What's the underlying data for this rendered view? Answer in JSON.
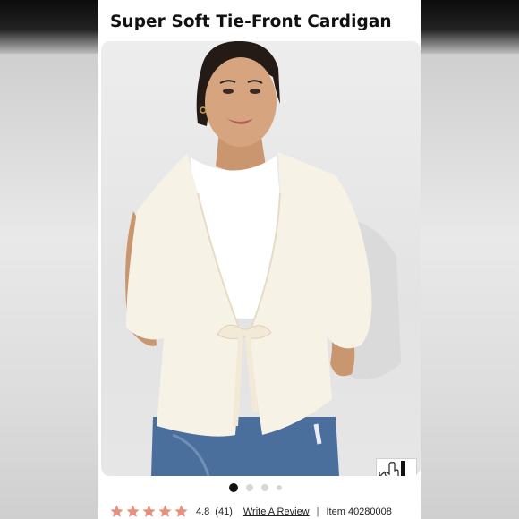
{
  "product": {
    "title": "Super Soft Tie-Front Cardigan",
    "rating": "4.8",
    "review_count": "(41)",
    "write_review_label": "Write A Review",
    "separator": "|",
    "item_number": "Item 40280008",
    "stars_filled": 5
  },
  "carousel": {
    "slide_count": 4,
    "active_index": 0
  },
  "icons": {
    "zoom": "expand-hand-icon",
    "star": "star-icon"
  },
  "colors": {
    "star": "#e8907e",
    "cardigan": "#f7f2e6",
    "tank": "#ffffff",
    "jeans": "#4a6f9c",
    "text": "#111111"
  }
}
